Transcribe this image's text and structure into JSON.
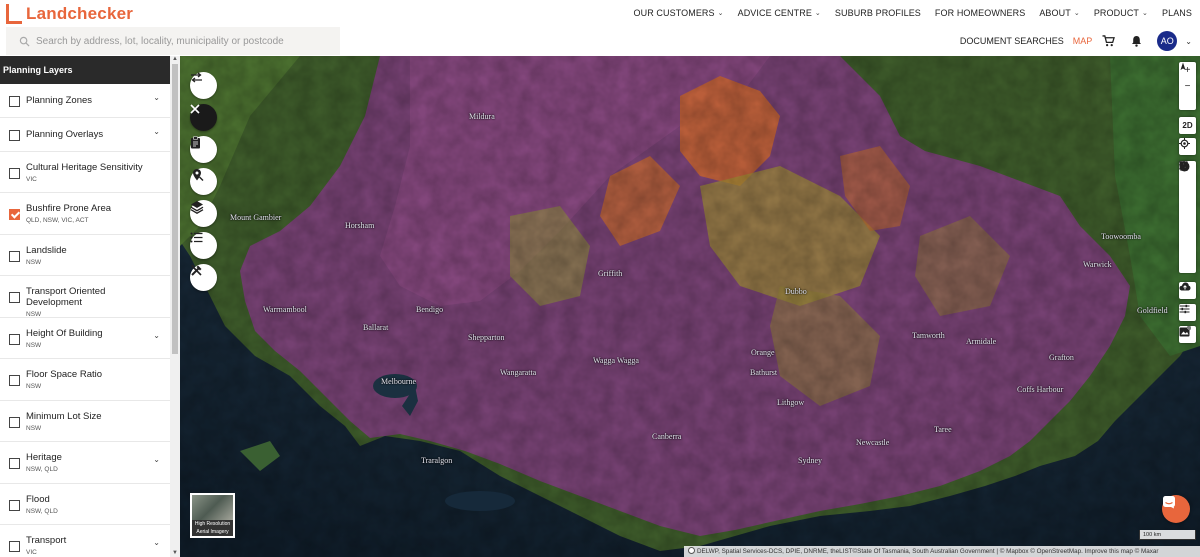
{
  "brand": {
    "name": "Landchecker",
    "accent": "#e8663c"
  },
  "search": {
    "placeholder": "Search by address, lot, locality, municipality or postcode"
  },
  "topnav": [
    {
      "label": "OUR CUSTOMERS",
      "dropdown": true
    },
    {
      "label": "ADVICE CENTRE",
      "dropdown": true
    },
    {
      "label": "SUBURB PROFILES",
      "dropdown": false
    },
    {
      "label": "FOR HOMEOWNERS",
      "dropdown": false
    },
    {
      "label": "ABOUT",
      "dropdown": true
    },
    {
      "label": "PRODUCT",
      "dropdown": true
    },
    {
      "label": "PLANS",
      "dropdown": false
    }
  ],
  "subnav": {
    "document_searches": "DOCUMENT SEARCHES",
    "map": "MAP",
    "avatar": "AO"
  },
  "sidebar": {
    "title": "Planning Layers",
    "layers": [
      {
        "label": "Planning Zones",
        "sub": "",
        "checked": false,
        "expandable": true
      },
      {
        "label": "Planning Overlays",
        "sub": "",
        "checked": false,
        "expandable": true
      },
      {
        "label": "Cultural Heritage Sensitivity",
        "sub": "VIC",
        "checked": false,
        "expandable": false
      },
      {
        "label": "Bushfire Prone Area",
        "sub": "QLD, NSW, VIC, ACT",
        "checked": true,
        "expandable": false
      },
      {
        "label": "Landslide",
        "sub": "NSW",
        "checked": false,
        "expandable": false
      },
      {
        "label": "Transport Oriented Development",
        "sub": "NSW",
        "checked": false,
        "expandable": false
      },
      {
        "label": "Height Of Building",
        "sub": "NSW",
        "checked": false,
        "expandable": true
      },
      {
        "label": "Floor Space Ratio",
        "sub": "NSW",
        "checked": false,
        "expandable": false
      },
      {
        "label": "Minimum Lot Size",
        "sub": "NSW",
        "checked": false,
        "expandable": false
      },
      {
        "label": "Heritage",
        "sub": "NSW, QLD",
        "checked": false,
        "expandable": true
      },
      {
        "label": "Flood",
        "sub": "NSW, QLD",
        "checked": false,
        "expandable": false
      },
      {
        "label": "Transport",
        "sub": "VIC",
        "checked": false,
        "expandable": true
      }
    ]
  },
  "map": {
    "places": [
      "Mildura",
      "Mount Gambier",
      "Horsham",
      "Griffith",
      "Dubbo",
      "Toowoomba",
      "Warwick",
      "Warrnambool",
      "Bendigo",
      "Ballarat",
      "Shepparton",
      "Wagga Wagga",
      "Orange",
      "Tamworth",
      "Armidale",
      "Grafton",
      "Goldfield",
      "Melbourne",
      "Wangaratta",
      "Bathurst",
      "Coffs Harbour",
      "Lithgow",
      "Canberra",
      "Newcastle",
      "Taree",
      "Sydney",
      "Traralgon"
    ],
    "aerial_label": "High Resolution Aerial Imagery",
    "mode_label": "2D",
    "scale": "100 km",
    "attribution": "DELWP, Spatial Services-DCS, DPIE, DNRME, theLIST©State Of Tasmania, South Australian Government | © Mapbox © OpenStreetMap. Improve this map © Maxar"
  }
}
